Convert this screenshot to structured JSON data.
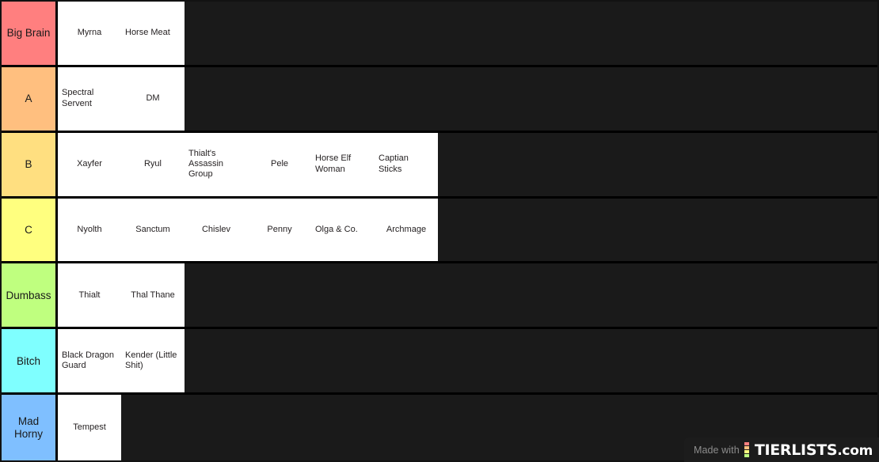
{
  "board": {
    "background_color": "#1a1a1a",
    "item_background_color": "#ffffff",
    "item_text_color": "#231f20",
    "divider_color": "#000000"
  },
  "tiers": [
    {
      "label": "Big Brain",
      "color": "#ff7f7f",
      "items": [
        {
          "text": "Myrna",
          "multiline": false
        },
        {
          "text": "Horse Meat",
          "multiline": true
        }
      ]
    },
    {
      "label": "A",
      "color": "#ffbf7f",
      "items": [
        {
          "text": "Spectral Servent",
          "multiline": true
        },
        {
          "text": "DM",
          "multiline": false
        }
      ]
    },
    {
      "label": "B",
      "color": "#ffdf80",
      "items": [
        {
          "text": "Xayfer",
          "multiline": false
        },
        {
          "text": "Ryul",
          "multiline": false
        },
        {
          "text": "Thialt's Assassin Group",
          "multiline": true
        },
        {
          "text": "Pele",
          "multiline": false
        },
        {
          "text": "Horse Elf Woman",
          "multiline": true
        },
        {
          "text": "Captian Sticks",
          "multiline": true
        }
      ]
    },
    {
      "label": "C",
      "color": "#ffff7f",
      "items": [
        {
          "text": "Nyolth",
          "multiline": false
        },
        {
          "text": "Sanctum",
          "multiline": false
        },
        {
          "text": "Chislev",
          "multiline": false
        },
        {
          "text": "Penny",
          "multiline": false
        },
        {
          "text": "Olga & Co.",
          "multiline": true
        },
        {
          "text": "Archmage",
          "multiline": false
        }
      ]
    },
    {
      "label": "Dumbass",
      "color": "#bfff7f",
      "items": [
        {
          "text": "Thialt",
          "multiline": false
        },
        {
          "text": "Thal Thane",
          "multiline": false
        }
      ]
    },
    {
      "label": "Bitch",
      "color": "#7fffff",
      "items": [
        {
          "text": "Black Dragon Guard",
          "multiline": true
        },
        {
          "text": "Kender (Little Shit)",
          "multiline": true
        }
      ]
    },
    {
      "label": "Mad Horny",
      "color": "#7fbfff",
      "items": [
        {
          "text": "Tempest",
          "multiline": false
        }
      ]
    }
  ],
  "watermark": {
    "made_with": "Made with",
    "brand_name": "TIERLISTS",
    "brand_suffix": ".com",
    "logo_colors": [
      "#ff7f7f",
      "#ffbf7f",
      "#ffff7f",
      "#bfff7f"
    ]
  }
}
